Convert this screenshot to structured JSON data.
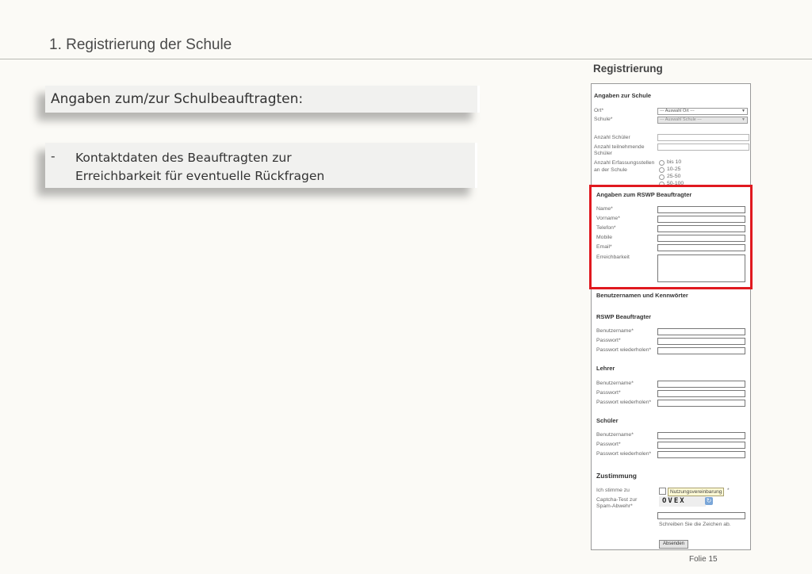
{
  "slide": {
    "title": "1. Registrierung der Schule",
    "footer": "Folie 15"
  },
  "callouts": {
    "heading": "Angaben zum/zur Schulbeauftragten:",
    "bullet_marker": "-",
    "bullet_line1": "Kontaktdaten des Beauftragten zur",
    "bullet_line2": "Erreichbarkeit für eventuelle Rückfragen"
  },
  "form": {
    "title": "Registrierung",
    "school_section": {
      "heading": "Angaben zur Schule",
      "ort_label": "Ort*",
      "ort_value": "--- Auswahl Ort ---",
      "schule_label": "Schule*",
      "schule_value": "--- Auswahl Schule ---",
      "anzahl_schueler_label": "Anzahl Schüler",
      "anzahl_teilnehmende_label1": "Anzahl teilnehmende",
      "anzahl_teilnehmende_label2": "Schüler",
      "erfassung_label1": "Anzahl Erfassungsstellen",
      "erfassung_label2": "an der Schule",
      "options": [
        "bis 10",
        "10-25",
        "25-50",
        "50-100"
      ]
    },
    "contact_section": {
      "heading": "Angaben zum RSWP Beauftragter",
      "name_label": "Name*",
      "vorname_label": "Vorname*",
      "telefon_label": "Telefon*",
      "mobile_label": "Mobile",
      "email_label": "Email*",
      "erreichbarkeit_label": "Erreichbarkeit"
    },
    "accounts_section": {
      "heading": "Benutzernamen und Kennwörter",
      "groups": [
        {
          "title": "RSWP Beauftragter",
          "user": "Benutzername*",
          "pass": "Passwort*",
          "repeat": "Passwort wiederholen*"
        },
        {
          "title": "Lehrer",
          "user": "Benutzername*",
          "pass": "Passwort*",
          "repeat": "Passwort wiederholen*"
        },
        {
          "title": "Schüler",
          "user": "Benutzername*",
          "pass": "Passwort*",
          "repeat": "Passwort wiederholen*"
        }
      ]
    },
    "consent_section": {
      "heading": "Zustimmung",
      "agree_label": "Ich stimme zu",
      "agreement_link": "Nutzungsvereinbarung",
      "agreement_star": "*",
      "captcha_label1": "Captcha-Test zur",
      "captcha_label2": "Spam-Abwehr*",
      "captcha_text": "OVEX",
      "captcha_hint": "Schreiben Sie die Zeichen ab.",
      "submit_label": "Absenden"
    },
    "highlight_color": "#e0191f"
  }
}
